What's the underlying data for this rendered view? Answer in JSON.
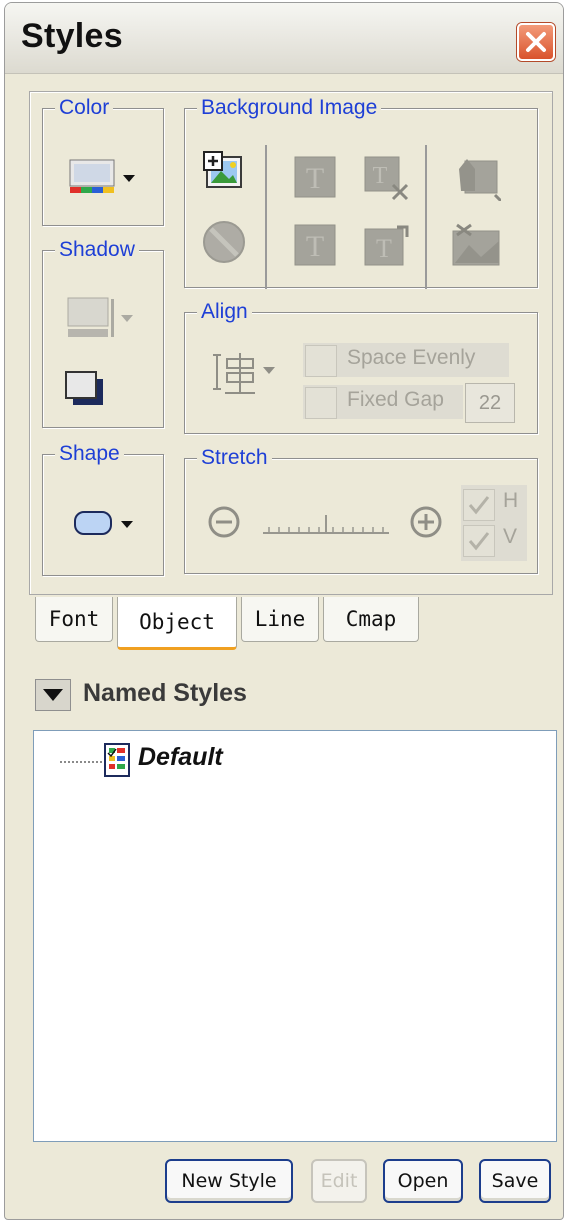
{
  "window": {
    "title": "Styles"
  },
  "object_panel": {
    "color_group": {
      "legend": "Color"
    },
    "shadow_group": {
      "legend": "Shadow"
    },
    "shape_group": {
      "legend": "Shape"
    },
    "background_image_group": {
      "legend": "Background Image"
    },
    "align_group": {
      "legend": "Align",
      "space_evenly_label": "Space Evenly",
      "fixed_gap_label": "Fixed Gap",
      "fixed_gap_value": "22"
    },
    "stretch_group": {
      "legend": "Stretch",
      "h_label": "H",
      "v_label": "V"
    }
  },
  "tabs": [
    {
      "label": "Font"
    },
    {
      "label": "Object",
      "active": true
    },
    {
      "label": "Line"
    },
    {
      "label": "Cmap"
    }
  ],
  "named_styles": {
    "title": "Named Styles",
    "items": [
      {
        "label": "Default"
      }
    ]
  },
  "buttons": {
    "new_style": "New Style",
    "edit": "Edit",
    "open": "Open",
    "save": "Save"
  },
  "colors": {
    "legend_text": "#1e3fd6",
    "active_tab_accent": "#f0a020",
    "button_border": "#1c3d8c"
  }
}
